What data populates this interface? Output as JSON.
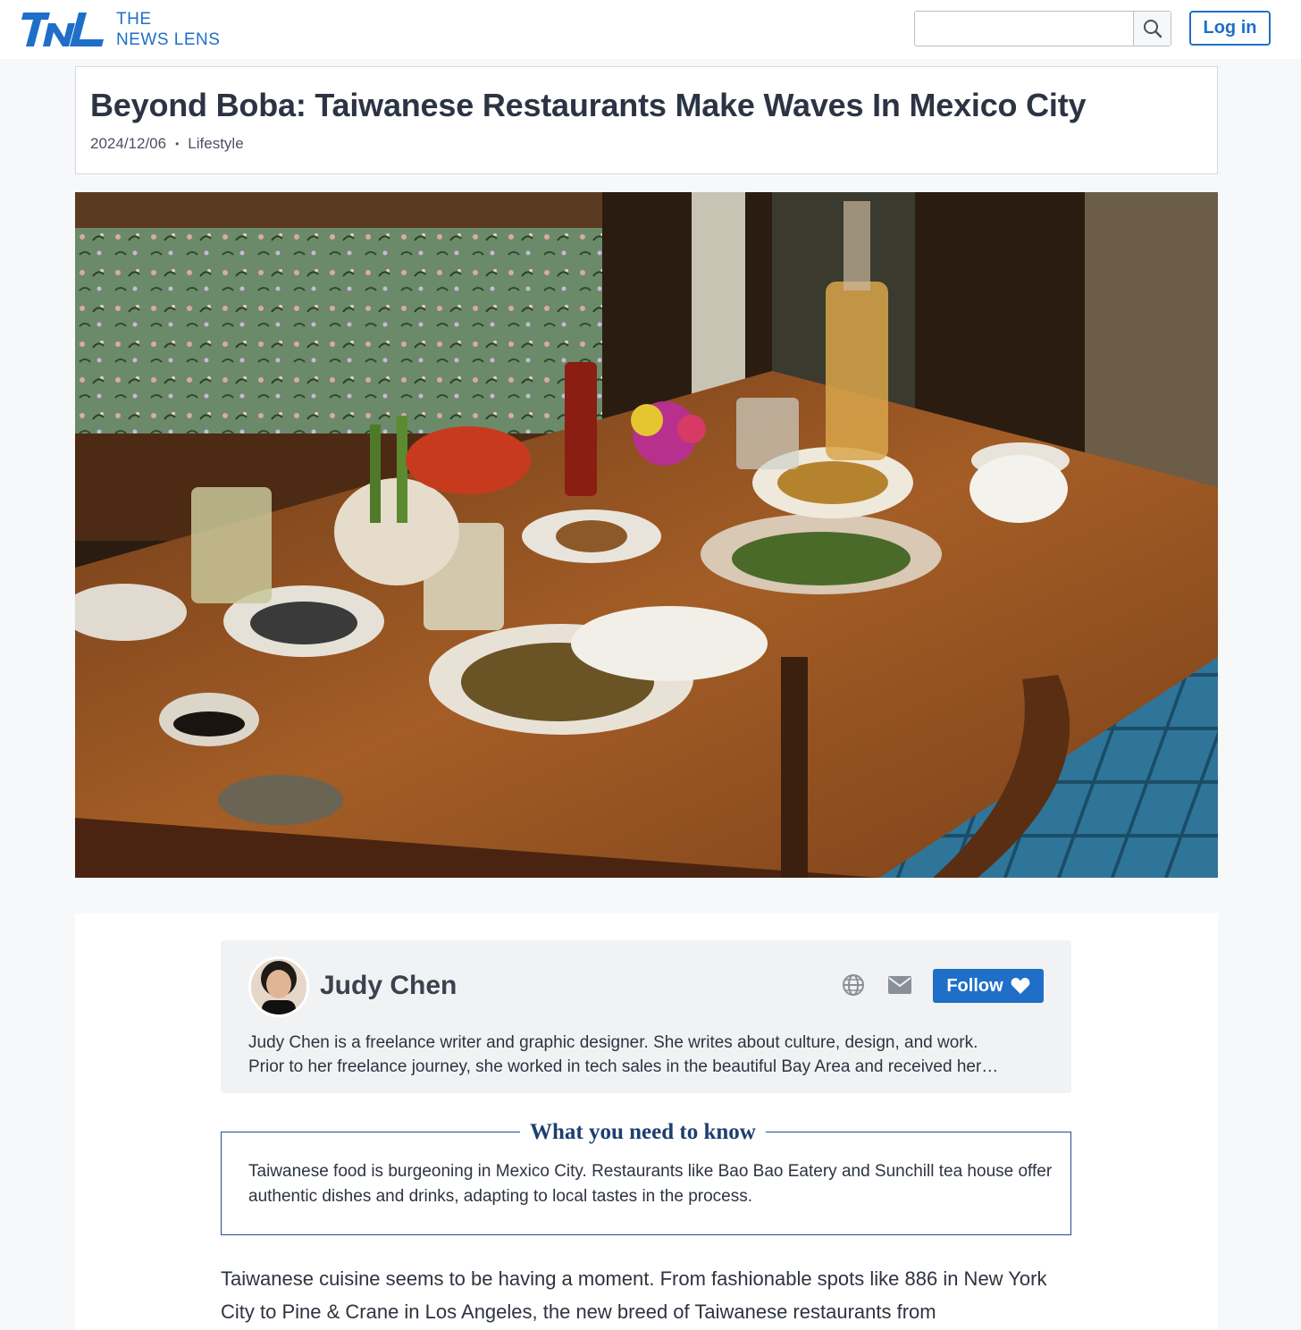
{
  "header": {
    "logo_line1": "THE",
    "logo_line2": "NEWS LENS",
    "search_placeholder": "",
    "login_label": "Log in",
    "brand_color": "#1f6fc9"
  },
  "article": {
    "title": "Beyond Boba: Taiwanese Restaurants Make Waves In Mexico City",
    "date": "2024/12/06",
    "separator": "•",
    "category": "Lifestyle"
  },
  "author": {
    "name": "Judy Chen",
    "follow_label": "Follow",
    "follow_icon": "heart-icon",
    "website_icon": "globe-icon",
    "email_icon": "envelope-icon",
    "bio_line1": "Judy Chen is a freelance writer and graphic designer. She writes about culture, design, and work.",
    "bio_line2": "Prior to her freelance journey, she worked in tech sales in the beautiful Bay Area and received her…"
  },
  "need_to_know": {
    "heading": "What you need to know",
    "text": "Taiwanese food is burgeoning in Mexico City. Restaurants like Bao Bao Eatery and Sunchill tea house offer authentic dishes and drinks, adapting to local tastes in the process."
  },
  "body": {
    "paragraph1": "Taiwanese cuisine seems to be having a moment. From fashionable spots like 886 in New York City to Pine & Crane in Los Angeles, the new breed of Taiwanese restaurants from"
  }
}
